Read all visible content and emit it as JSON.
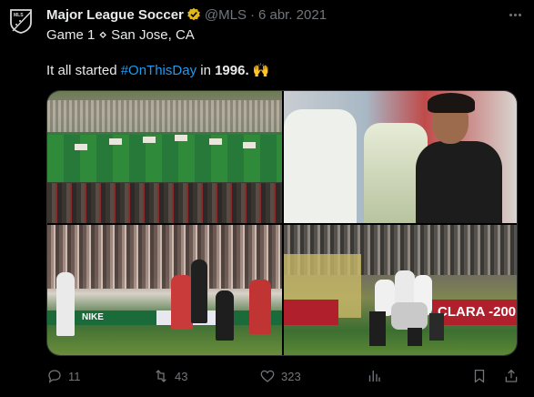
{
  "tweet": {
    "author_name": "Major League Soccer",
    "handle": "@MLS",
    "separator": "·",
    "date": "6 abr. 2021",
    "line1": "Game 1 ⋄ San Jose, CA",
    "line2_before": "It all started ",
    "hashtag": "#OnThisDay",
    "line2_middle": " in ",
    "year": "1996.",
    "emoji": " 🙌",
    "avatar_text": "MLS"
  },
  "media": {
    "ad_text": "CLARA\n-200",
    "board_text": "NIKE"
  },
  "actions": {
    "replies": "11",
    "retweets": "43",
    "likes": "323"
  },
  "colors": {
    "background": "#000000",
    "text": "#e7e9ea",
    "secondary": "#71767b",
    "link": "#1d9bf0",
    "verified": "#e2b719"
  }
}
